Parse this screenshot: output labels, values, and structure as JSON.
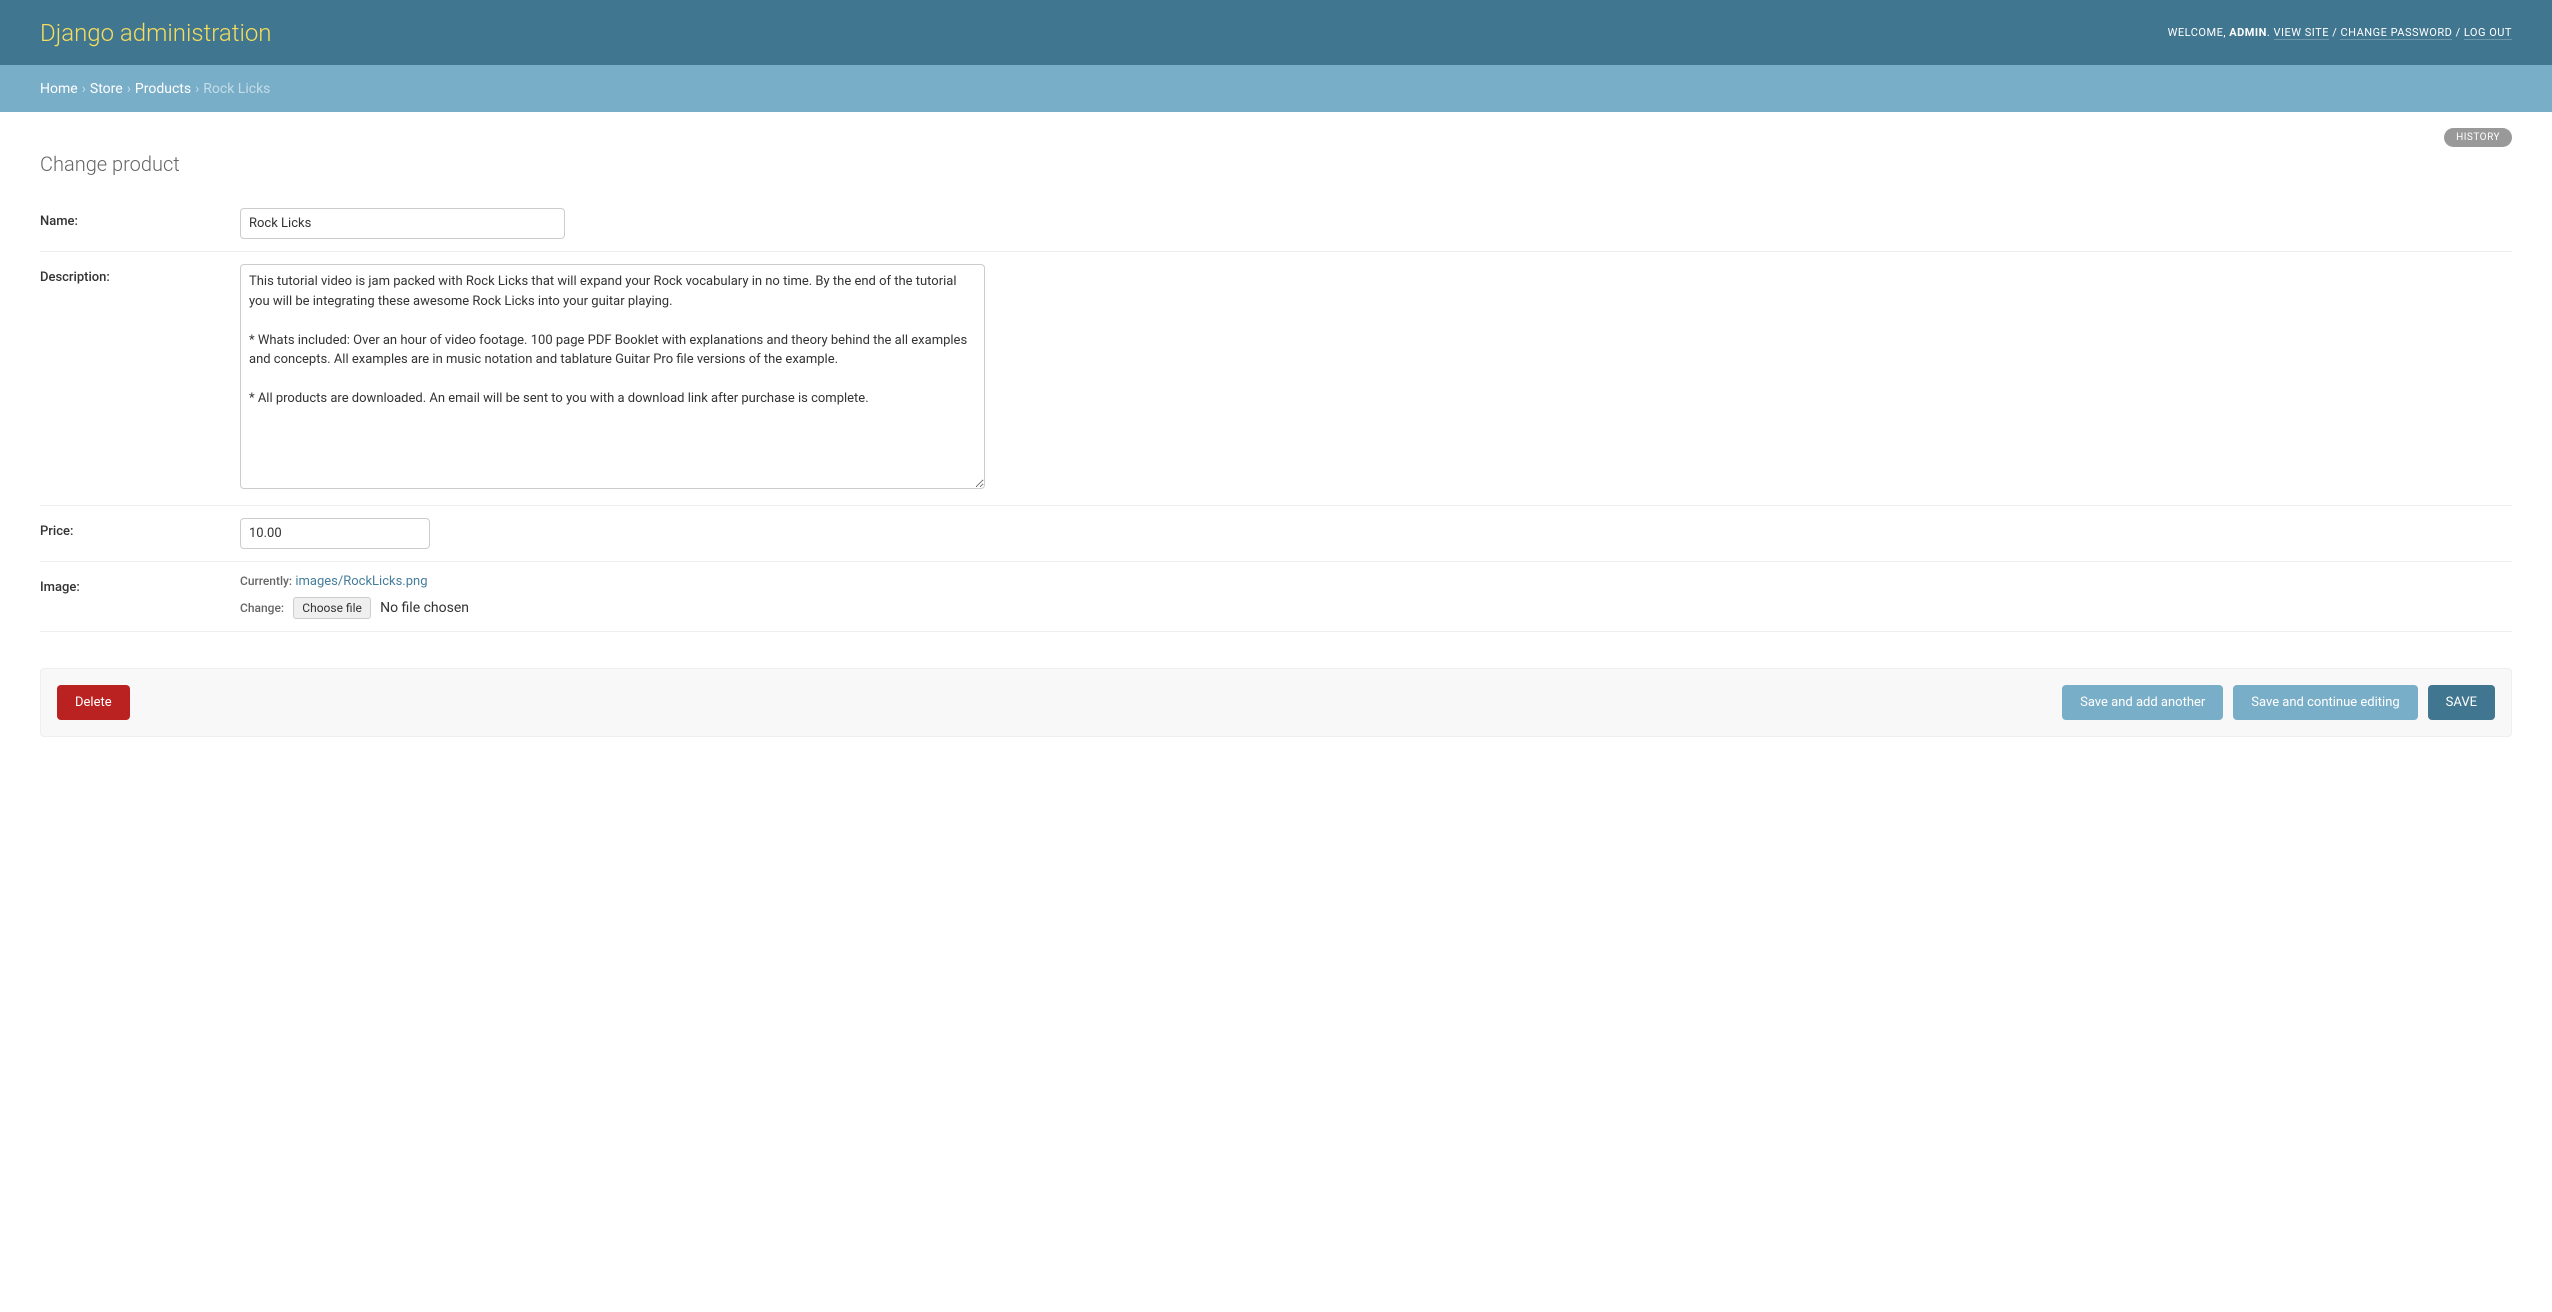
{
  "header": {
    "site_title": "Django administration",
    "welcome_prefix": "WELCOME, ",
    "username": "ADMIN",
    "view_site": "VIEW SITE",
    "change_password": "CHANGE PASSWORD",
    "log_out": "LOG OUT"
  },
  "breadcrumbs": {
    "items": [
      "Home",
      "Store",
      "Products"
    ],
    "current": "Rock Licks",
    "sep": "›"
  },
  "page": {
    "title": "Change product",
    "history_label": "HISTORY"
  },
  "form": {
    "name": {
      "label": "Name:",
      "value": "Rock Licks"
    },
    "description": {
      "label": "Description:",
      "value": "This tutorial video is jam packed with Rock Licks that will expand your Rock vocabulary in no time. By the end of the tutorial you will be integrating these awesome Rock Licks into your guitar playing.\n\n* Whats included: Over an hour of video footage. 100 page PDF Booklet with explanations and theory behind the all examples and concepts. All examples are in music notation and tablature Guitar Pro file versions of the example.\n\n* All products are downloaded. An email will be sent to you with a download link after purchase is complete."
    },
    "price": {
      "label": "Price:",
      "value": "10.00"
    },
    "image": {
      "label": "Image:",
      "currently_label": "Currently:",
      "current_file": "images/RockLicks.png",
      "change_label": "Change:",
      "choose_file_label": "Choose file",
      "no_file_text": "No file chosen"
    }
  },
  "actions": {
    "delete": "Delete",
    "save_add_another": "Save and add another",
    "save_continue": "Save and continue editing",
    "save": "SAVE"
  }
}
